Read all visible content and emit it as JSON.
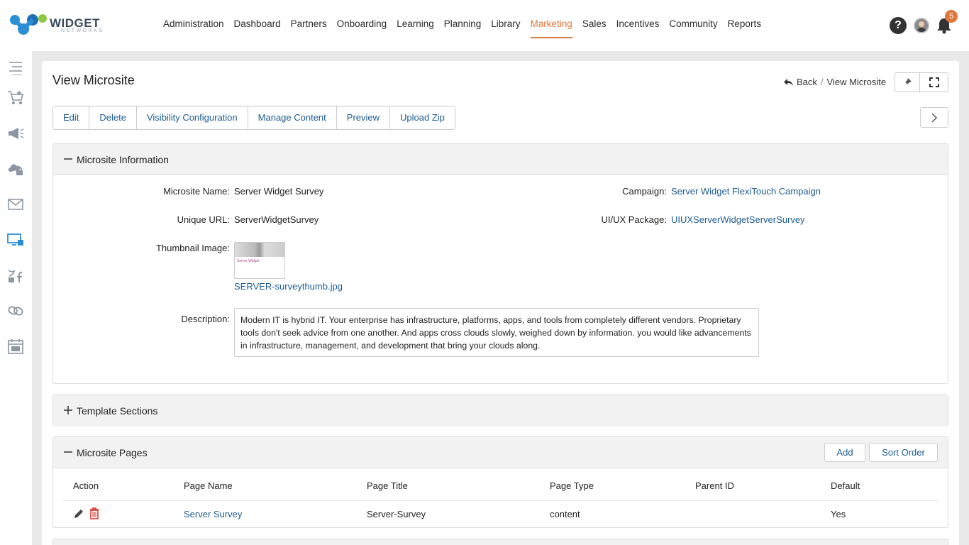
{
  "brand": {
    "name": "WIDGET",
    "sub": "NETWORKS"
  },
  "nav": [
    {
      "label": "Administration"
    },
    {
      "label": "Dashboard"
    },
    {
      "label": "Partners"
    },
    {
      "label": "Onboarding"
    },
    {
      "label": "Learning"
    },
    {
      "label": "Planning"
    },
    {
      "label": "Library"
    },
    {
      "label": "Marketing",
      "active": true
    },
    {
      "label": "Sales"
    },
    {
      "label": "Incentives"
    },
    {
      "label": "Community"
    },
    {
      "label": "Reports"
    }
  ],
  "header_icons": {
    "help": "?",
    "notifications_count": "5"
  },
  "sidebar_icons": [
    "menu-icon",
    "cart-icon",
    "megaphone-icon",
    "cloud-lock-icon",
    "mail-icon",
    "microsite-icon",
    "social-icon",
    "link-icon",
    "calendar-icon"
  ],
  "page": {
    "title": "View Microsite",
    "breadcrumb": {
      "back": "Back",
      "separator": "/",
      "current": "View Microsite"
    }
  },
  "actions": [
    "Edit",
    "Delete",
    "Visibility Configuration",
    "Manage Content",
    "Preview",
    "Upload Zip"
  ],
  "info_panel": {
    "title": "Microsite Information",
    "microsite_name_label": "Microsite Name:",
    "microsite_name": "Server Widget Survey",
    "unique_url_label": "Unique URL:",
    "unique_url": "ServerWidgetSurvey",
    "thumbnail_label": "Thumbnail Image:",
    "thumbnail_file": "SERVER-surveythumb.jpg",
    "thumbnail_caption": "Server Widget",
    "description_label": "Description:",
    "description": "Modern IT is hybrid IT. Your enterprise has infrastructure, platforms, apps, and tools from completely different vendors. Proprietary tools don't seek advice from one another. And apps cross clouds slowly, weighed down by information. you would like advancements in infrastructure, management, and development that bring your clouds along.",
    "campaign_label": "Campaign:",
    "campaign": "Server Widget FlexiTouch Campaign",
    "package_label": "UI/UX Package:",
    "package": "UIUXServerWidgetServerSurvey"
  },
  "template_panel": {
    "title": "Template Sections"
  },
  "pages_panel": {
    "title": "Microsite Pages",
    "add_label": "Add",
    "sort_label": "Sort Order",
    "columns": [
      "Action",
      "Page Name",
      "Page Title",
      "Page Type",
      "Parent ID",
      "Default"
    ],
    "rows": [
      {
        "page_name": "Server Survey",
        "page_title": "Server-Survey",
        "page_type": "content",
        "parent_id": "",
        "default": "Yes"
      }
    ]
  },
  "colors": {
    "accent": "#e0773b",
    "link": "#1d5c91",
    "delete": "#d9342b"
  }
}
